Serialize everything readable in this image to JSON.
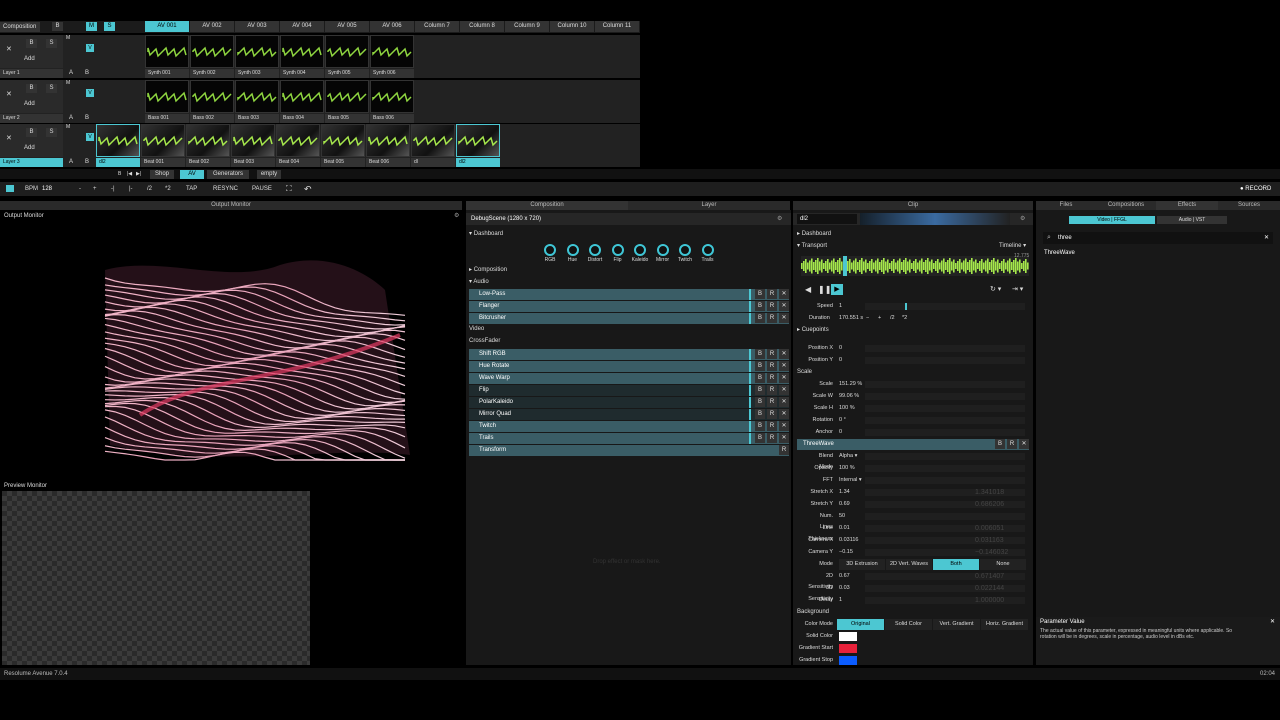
{
  "composition": {
    "label": "Composition",
    "b": "B",
    "s": "S",
    "m": "M",
    "sol": "S"
  },
  "columns": [
    "AV 001",
    "AV 002",
    "AV 003",
    "AV 004",
    "AV 005",
    "AV 006",
    "Column 7",
    "Column 8",
    "Column 9",
    "Column 10",
    "Column 11"
  ],
  "layers": [
    {
      "name": "Layer 3",
      "clips": [
        "Synth 001",
        "Synth 002",
        "Synth 003",
        "Synth 004",
        "Synth 005",
        "Synth 006"
      ]
    },
    {
      "name": "Layer 2",
      "clips": [
        "Bass 001",
        "Bass 002",
        "Bass 003",
        "Bass 004",
        "Bass 005",
        "Bass 006"
      ]
    },
    {
      "name": "Layer 1",
      "clips": [
        "dl2",
        "Beat 001",
        "Beat 002",
        "Beat 003",
        "Beat 004",
        "Beat 005",
        "Beat 006",
        "dl",
        "dl2"
      ]
    }
  ],
  "layer_ctrl": {
    "x": "✕",
    "b": "B",
    "s": "S",
    "add": "Add",
    "a": "A",
    "bb": "B",
    "m": "M",
    "v": "V"
  },
  "transport": {
    "bpm_label": "BPM",
    "bpm": "128",
    "tabs": [
      "Shop",
      "AV",
      "Generators",
      "empty"
    ],
    "buttons": [
      "-",
      "+",
      "-|",
      "|-",
      "/2",
      "*2",
      "TAP",
      "RESYNC",
      "PAUSE"
    ],
    "record": "● RECORD",
    "mini": [
      "B",
      "|◀",
      "▶|"
    ]
  },
  "panels": {
    "output": "Output Monitor",
    "composition": "Composition",
    "layer": "Layer",
    "clip": "Clip",
    "files": "Files",
    "compositions": "Compositions",
    "effects": "Effects",
    "sources": "Sources"
  },
  "output_monitor": {
    "title": "Output Monitor",
    "preview": "Preview Monitor"
  },
  "comp_panel": {
    "title": "DebugScene (1280 x 720)",
    "dashboard": "Dashboard",
    "knobs": [
      "RGB",
      "Hue",
      "Distort",
      "Flip",
      "Kaleido",
      "Mirror",
      "Twitch",
      "Trails"
    ],
    "composition": "Composition",
    "audio": "Audio",
    "audio_fx": [
      "Low-Pass",
      "Flanger",
      "Bitcrusher"
    ],
    "video": "Video",
    "crossfader": "CrossFader",
    "video_fx": [
      "Shift RGB",
      "Hue Rotate",
      "Wave Warp",
      "Flip",
      "PolarKaleido",
      "Mirror Quad",
      "Twitch",
      "Trails"
    ],
    "transform": "Transform",
    "drop_hint": "Drop effect or mask here.",
    "fx_b": "B",
    "fx_r": "R",
    "fx_x": "✕",
    "tr_r": "R"
  },
  "clip_panel": {
    "name": "dl2",
    "dashboard": "Dashboard",
    "transport": "Transport",
    "timeline": "Timeline ▾",
    "time": "12.775",
    "speed_label": "Speed",
    "speed": "1",
    "duration_label": "Duration",
    "duration": "170.551 s",
    "dur_btns": [
      "−",
      "+",
      "/2",
      "*2"
    ],
    "cuepoints": "Cuepoints",
    "params": [
      {
        "l": "Position X",
        "v": "0"
      },
      {
        "l": "Position Y",
        "v": "0"
      }
    ],
    "scale_group": "Scale",
    "scale": [
      {
        "l": "Scale",
        "v": "151.29 %"
      },
      {
        "l": "Scale W",
        "v": "99.06 %"
      },
      {
        "l": "Scale H",
        "v": "100 %"
      }
    ],
    "rotation_l": "Rotation",
    "rotation": "0 °",
    "anchor_l": "Anchor",
    "anchor": "0",
    "threewave": "ThreeWave",
    "tw_b": "B",
    "tw_r": "R",
    "tw_x": "✕",
    "blend_l": "Blend Mode",
    "blend": "Alpha ▾",
    "opacity_l": "Opacity",
    "opacity": "100 %",
    "fft_l": "FFT",
    "fft": "Internal ▾",
    "tw_params": [
      {
        "l": "Stretch X",
        "v": "1.34",
        "g": "1.341018"
      },
      {
        "l": "Stretch Y",
        "v": "0.69",
        "g": "0.686206"
      },
      {
        "l": "Num. Lines",
        "v": "50",
        "g": ""
      },
      {
        "l": "Line Thickness",
        "v": "0.01",
        "g": "0.006051"
      },
      {
        "l": "Camera X",
        "v": "0.03116",
        "g": "0.031163"
      },
      {
        "l": "Camera Y",
        "v": "−0.15",
        "g": "−0.146032"
      }
    ],
    "mode_l": "Mode",
    "modes": [
      "3D Extrusion",
      "2D Vert. Waves",
      "Both",
      "None"
    ],
    "sens": [
      {
        "l": "2D Sensitivity",
        "v": "0.67",
        "g": "0.671407"
      },
      {
        "l": "3D Sensitivity",
        "v": "0.03",
        "g": "0.022144"
      },
      {
        "l": "Delay",
        "v": "1",
        "g": "1.000000"
      }
    ],
    "background": "Background",
    "colormode_l": "Color Mode",
    "colormodes": [
      "Original",
      "Solid Color",
      "Vert. Gradient",
      "Horiz. Gradient"
    ],
    "solid_l": "Solid Color",
    "gstart_l": "Gradient Start",
    "gstop_l": "Gradient Stop"
  },
  "browser": {
    "tabs": [
      "Video | FFGL",
      "Audio | VST"
    ],
    "search": "three",
    "result": "ThreeWave"
  },
  "param_help": {
    "title": "Parameter Value",
    "text": "The actual value of this parameter, expressed in meaningful units where applicable. So rotation will be in degrees, scale in percentage, audio level in dBs etc."
  },
  "status": {
    "app": "Resolume Avenue 7.0.4",
    "time": "02:04"
  },
  "colors": {
    "accent": "#4cc7d2",
    "solid": "#ffffff",
    "gradient_start": "#e8213a",
    "gradient_stop": "#0b5cff",
    "waveform": "#a6e84c"
  }
}
